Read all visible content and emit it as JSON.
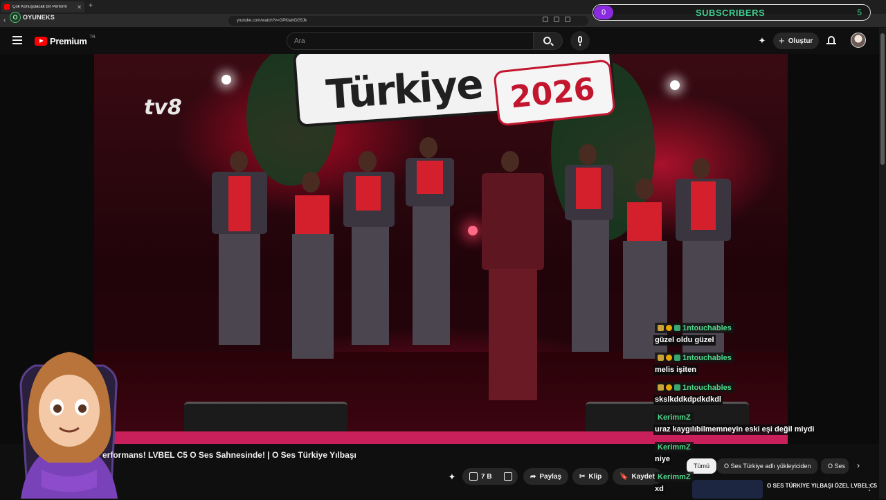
{
  "browser": {
    "tab_title": "Çok Konuşulacak Bir Perform",
    "url": "youtube.com/watch?v=GPKtahGG5Jk",
    "brand_name": "OYUNEKS"
  },
  "overlay": {
    "subscriber_count": "0",
    "subscribers_label": "SUBSCRIBERS",
    "subscriber_goal": "5"
  },
  "header": {
    "logo_text": "Premium",
    "country_code": "TR",
    "search_placeholder": "Ara",
    "create_label": "Oluştur"
  },
  "video": {
    "channel_watermark": "tv8",
    "show_logo_year": "2026",
    "show_logo_text": "Türkiye",
    "title": "erformans! LVBEL C5 O Ses Sahnesinde! | O Ses Türkiye Yılbaşı"
  },
  "actions": {
    "like_count": "7 B",
    "share_label": "Paylaş",
    "clip_label": "Klip",
    "save_label": "Kaydet"
  },
  "recommendation_chips": [
    "Tümü",
    "O Ses Türkiye adlı yükleyiciden",
    "O Ses"
  ],
  "recommendation": {
    "title": "O SES TÜRKİYE YILBAŞI ÖZEL LVBEL C5"
  },
  "chat": [
    {
      "user": "1ntouchables",
      "text": "güzel oldu güzel"
    },
    {
      "user": "1ntouchables",
      "text": "melis işiten"
    },
    {
      "user": "1ntouchables",
      "text": "skslkddkdpdkdkdl"
    },
    {
      "user": "KerimmZ",
      "text": "uraz kaygılıbilmemneyin eski eşi değil miydi"
    },
    {
      "user": "KerimmZ",
      "text": "niye"
    },
    {
      "user": "KerimmZ",
      "text": "xd"
    }
  ],
  "colors": {
    "youtube_red": "#ff0000",
    "chat_username": "#4fd98a",
    "subscriber_accent": "#3ecf8e",
    "subscriber_count_bg": "#8a2be2"
  }
}
